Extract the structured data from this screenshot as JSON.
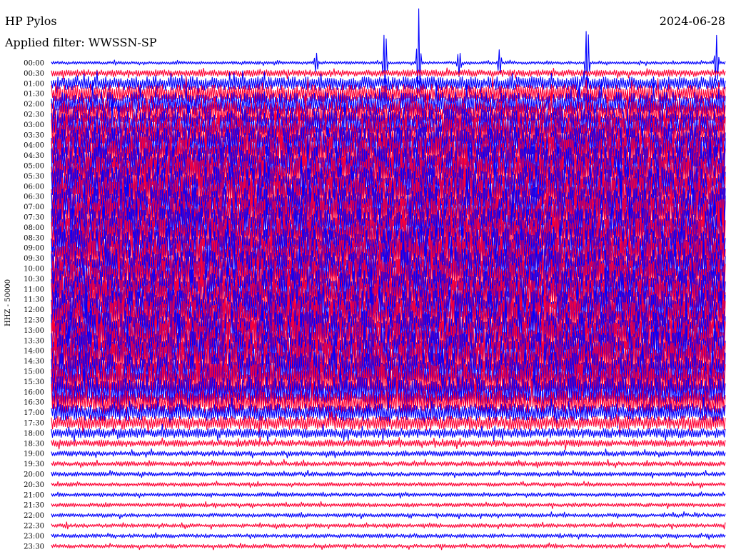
{
  "header": {
    "station_title": "HP Pylos",
    "filter_label": "Applied filter: WWSSN-SP",
    "date": "2024-06-28"
  },
  "chart_data": {
    "type": "line",
    "title": "HP Pylos",
    "subtitle": "Applied filter: WWSSN-SP",
    "date": "2024-06-28",
    "ylabel": "HHZ - 50000",
    "xlabel": "",
    "row_tick_labels": [
      "00:00",
      "00:30",
      "01:00",
      "01:30",
      "02:00",
      "02:30",
      "03:00",
      "03:30",
      "04:00",
      "04:30",
      "05:00",
      "05:30",
      "06:00",
      "06:30",
      "07:00",
      "07:30",
      "08:00",
      "08:30",
      "09:00",
      "09:30",
      "10:00",
      "10:30",
      "11:00",
      "11:30",
      "12:00",
      "12:30",
      "13:00",
      "13:30",
      "14:00",
      "14:30",
      "15:00",
      "15:30",
      "16:00",
      "16:30",
      "17:00",
      "17:30",
      "18:00",
      "18:30",
      "19:00",
      "19:30",
      "20:00",
      "20:30",
      "21:00",
      "21:30",
      "22:00",
      "22:30",
      "23:00",
      "23:30"
    ],
    "trace_minutes_per_row": 30,
    "series_colors": [
      "#0000ff",
      "#ff0033"
    ],
    "row_relative_amplitude": [
      0.35,
      0.8,
      1.6,
      2.2,
      2.8,
      3.2,
      3.6,
      4.0,
      4.2,
      4.4,
      4.6,
      4.6,
      4.6,
      4.6,
      4.6,
      4.6,
      4.6,
      4.6,
      4.6,
      4.6,
      4.6,
      4.6,
      4.6,
      4.6,
      4.6,
      4.6,
      4.6,
      4.6,
      4.6,
      4.6,
      4.4,
      4.2,
      3.6,
      2.8,
      2.0,
      1.6,
      1.1,
      0.8,
      0.6,
      0.55,
      0.5,
      0.45,
      0.45,
      0.45,
      0.45,
      0.45,
      0.45,
      0.45
    ],
    "events": [
      {
        "row": 0,
        "x_fraction": 0.495,
        "relative_height": 6
      },
      {
        "row": 0,
        "x_fraction": 0.545,
        "relative_height": 8
      },
      {
        "row": 0,
        "x_fraction": 0.795,
        "relative_height": 7
      },
      {
        "row": 0,
        "x_fraction": 0.987,
        "relative_height": 4
      },
      {
        "row": 0,
        "x_fraction": 0.665,
        "relative_height": 2
      },
      {
        "row": 0,
        "x_fraction": 0.605,
        "relative_height": 2
      },
      {
        "row": 0,
        "x_fraction": 0.393,
        "relative_height": 1.5
      }
    ]
  }
}
